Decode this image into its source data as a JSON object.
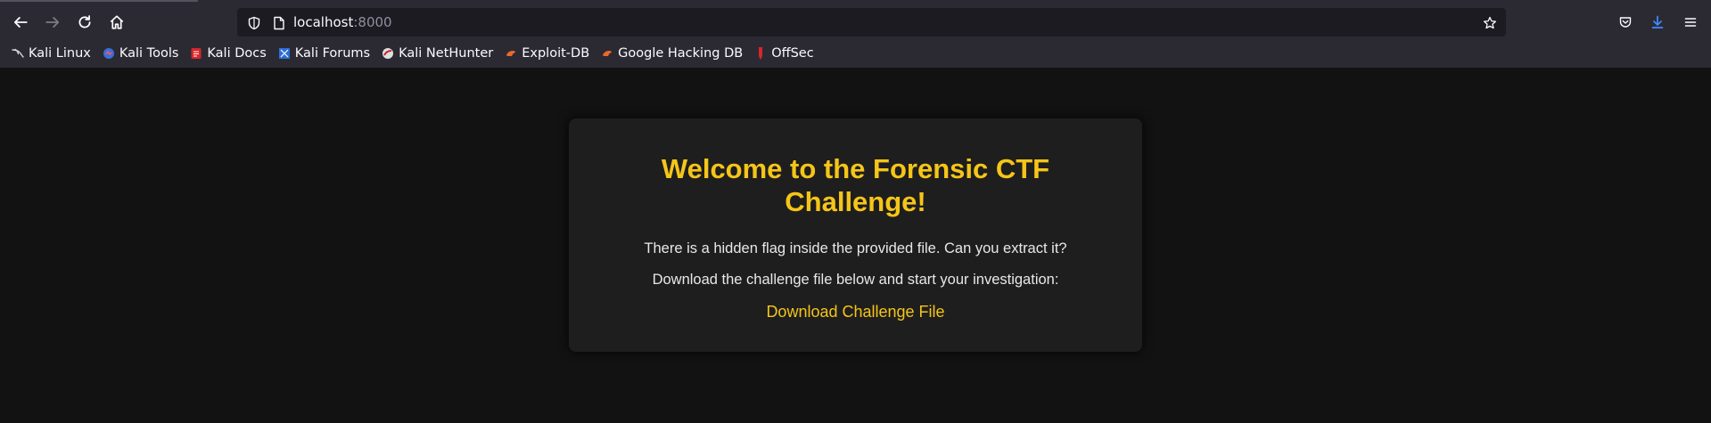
{
  "browser": {
    "url_host": "localhost",
    "url_port": ":8000",
    "icons": {
      "back": "arrow-left-icon",
      "forward": "arrow-right-icon",
      "reload": "reload-icon",
      "home": "home-icon",
      "shield": "shield-icon",
      "page": "page-icon",
      "bookmark_star": "star-icon",
      "pocket": "pocket-icon",
      "downloads": "download-icon",
      "menu": "hamburger-menu-icon"
    },
    "accent_color": "#3f8cff"
  },
  "bookmarks": [
    {
      "label": "Kali Linux",
      "icon": "kali-dragon-icon"
    },
    {
      "label": "Kali Tools",
      "icon": "kali-tools-icon"
    },
    {
      "label": "Kali Docs",
      "icon": "kali-docs-icon"
    },
    {
      "label": "Kali Forums",
      "icon": "kali-forums-icon"
    },
    {
      "label": "Kali NetHunter",
      "icon": "nethunter-icon"
    },
    {
      "label": "Exploit-DB",
      "icon": "exploit-db-icon"
    },
    {
      "label": "Google Hacking DB",
      "icon": "ghdb-icon"
    },
    {
      "label": "OffSec",
      "icon": "offsec-icon"
    }
  ],
  "page": {
    "title": "Welcome to the Forensic CTF Challenge!",
    "intro": "There is a hidden flag inside the provided file. Can you extract it?",
    "instruction": "Download the challenge file below and start your investigation:",
    "download_label": "Download Challenge File",
    "accent_color": "#f5c518",
    "background_color": "#121212",
    "card_color": "#1e1e1e"
  }
}
